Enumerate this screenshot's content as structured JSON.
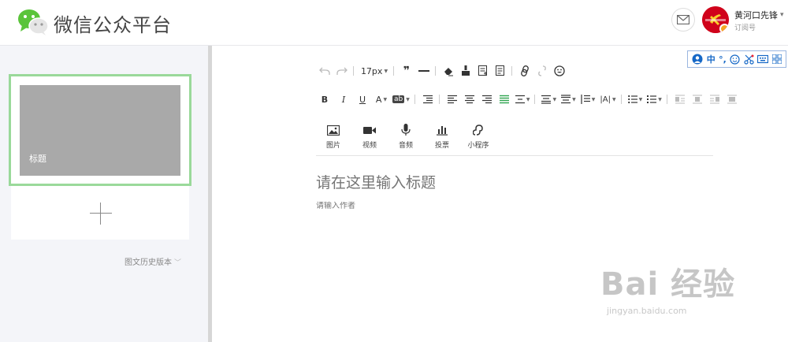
{
  "header": {
    "logo_text": "微信公众平台",
    "account_name": "黄河口先锋",
    "account_type": "订阅号",
    "arrow": "▾"
  },
  "sidebar": {
    "card_title": "标题",
    "history_label": "图文历史版本"
  },
  "ime": {
    "chinese": "中",
    "punct": "°,"
  },
  "toolbar": {
    "font_size": "17px",
    "highlight": "ab",
    "bold": "B",
    "italic": "I",
    "underline": "U",
    "font_color": "A",
    "line_height": "|A|"
  },
  "media": [
    {
      "label": "图片"
    },
    {
      "label": "视频"
    },
    {
      "label": "音频"
    },
    {
      "label": "投票"
    },
    {
      "label": "小程序"
    }
  ],
  "editor": {
    "title_placeholder": "请在这里输入标题",
    "author_placeholder": "请输入作者"
  },
  "watermark": {
    "main": "Bai 经验",
    "sub": "jingyan.baidu.com"
  },
  "colors": {
    "brand_green": "#2ea44f",
    "card_border": "#9ad99a",
    "avatar_red": "#d0021b"
  }
}
